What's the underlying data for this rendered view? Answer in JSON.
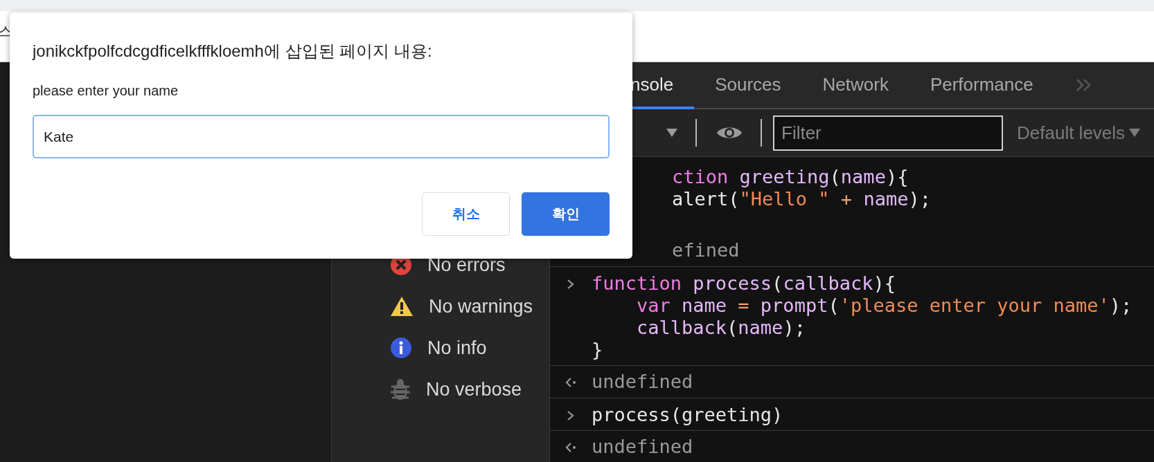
{
  "page": {
    "fragment": "스"
  },
  "devtools": {
    "tabs": [
      {
        "label": "nsole",
        "selected": true
      },
      {
        "label": "Sources",
        "selected": false
      },
      {
        "label": "Network",
        "selected": false
      },
      {
        "label": "Performance",
        "selected": false
      }
    ],
    "filter": {
      "placeholder": "Filter"
    },
    "levels": "Default levels",
    "sidebar": [
      {
        "kind": "error",
        "label": "No errors"
      },
      {
        "kind": "warning",
        "label": "No warnings"
      },
      {
        "kind": "info",
        "label": "No info"
      },
      {
        "kind": "verbose",
        "label": "No verbose"
      }
    ],
    "console": [
      {
        "kind": "clipped",
        "lines": [
          [
            {
              "kind": "keyword",
              "text": "ction "
            },
            {
              "kind": "name",
              "text": "greeting"
            },
            {
              "kind": "punct",
              "text": "("
            },
            {
              "kind": "name",
              "text": "name"
            },
            {
              "kind": "punct",
              "text": "){"
            }
          ],
          [
            {
              "kind": "plain",
              "text": "alert("
            },
            {
              "kind": "string",
              "text": "\"Hello \""
            },
            {
              "kind": "operator",
              "text": " + "
            },
            {
              "kind": "name",
              "text": "name"
            },
            {
              "kind": "punct",
              "text": ");"
            }
          ]
        ]
      },
      {
        "kind": "clipped-result",
        "lines": [
          [
            {
              "kind": "muted",
              "text": "efined"
            }
          ]
        ]
      },
      {
        "kind": "input",
        "lines": [
          [
            {
              "kind": "keyword",
              "text": "function "
            },
            {
              "kind": "name",
              "text": "process"
            },
            {
              "kind": "punct",
              "text": "("
            },
            {
              "kind": "name",
              "text": "callback"
            },
            {
              "kind": "punct",
              "text": "){"
            }
          ],
          [
            {
              "kind": "keyword",
              "text": "    var "
            },
            {
              "kind": "name",
              "text": "name"
            },
            {
              "kind": "operator",
              "text": " = "
            },
            {
              "kind": "name",
              "text": "prompt"
            },
            {
              "kind": "punct",
              "text": "("
            },
            {
              "kind": "string",
              "text": "'please enter your name'"
            },
            {
              "kind": "punct",
              "text": ");"
            }
          ],
          [
            {
              "kind": "name",
              "text": "    callback"
            },
            {
              "kind": "punct",
              "text": "("
            },
            {
              "kind": "name",
              "text": "name"
            },
            {
              "kind": "punct",
              "text": ");"
            }
          ],
          [
            {
              "kind": "punct",
              "text": "}"
            }
          ]
        ]
      },
      {
        "kind": "result",
        "lines": [
          [
            {
              "kind": "muted",
              "text": "undefined"
            }
          ]
        ]
      },
      {
        "kind": "input",
        "lines": [
          [
            {
              "kind": "punct",
              "text": "process(greeting)"
            }
          ]
        ]
      },
      {
        "kind": "result",
        "lines": [
          [
            {
              "kind": "muted",
              "text": "undefined"
            }
          ]
        ]
      }
    ]
  },
  "dialog": {
    "title": "jonikckfpolfcdcgdficelkfffkloemh에 삽입된 페이지 내용:",
    "message": "please enter your name",
    "value": "Kate",
    "buttons": [
      {
        "label": "취소",
        "kind": "secondary"
      },
      {
        "label": "확인",
        "kind": "primary"
      }
    ]
  }
}
